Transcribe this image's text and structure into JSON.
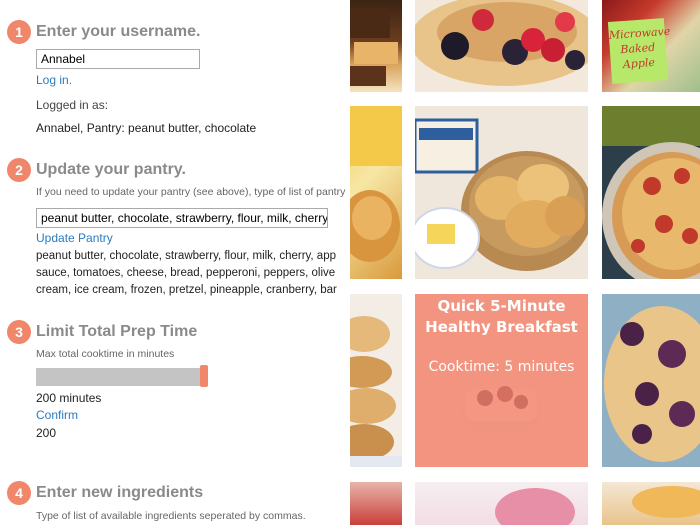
{
  "steps": [
    {
      "number": "1",
      "title": "Enter your username."
    },
    {
      "number": "2",
      "title": "Update your pantry."
    },
    {
      "number": "3",
      "title": "Limit Total Prep Time"
    },
    {
      "number": "4",
      "title": "Enter new ingredients"
    }
  ],
  "login": {
    "username_value": "Annabel",
    "login_link": "Log in.",
    "logged_in_label": "Logged in as:",
    "logged_in_info": "Annabel, Pantry: peanut butter, chocolate"
  },
  "pantry": {
    "hint": "If you need to update your pantry (see above), type of list of pantry",
    "input_value": "peanut butter, chocolate, strawberry, flour, milk, cherry",
    "update_link": "Update Pantry",
    "list_lines": [
      "peanut butter, chocolate, strawberry, flour, milk, cherry, app",
      "sauce, tomatoes, cheese, bread, pepperoni, peppers, olive",
      "cream, ice cream, frozen, pretzel, pineapple, cranberry, bar"
    ]
  },
  "prep_time": {
    "hint": "Max total cooktime in minutes",
    "slider_fraction": 1.0,
    "minutes_label": "200 minutes",
    "confirm_link": "Confirm",
    "confirmed_value": "200"
  },
  "ingredients": {
    "hint": "Type of list of available ingredients seperated by commas."
  },
  "recipe_grid": {
    "note_text": "Microwave Baked Apple",
    "featured_title_line1": "Quick 5-Minute",
    "featured_title_line2": "Healthy Breakfast",
    "featured_cooktime": "Cooktime: 5 minutes"
  },
  "colors": {
    "accent": "#f0866a",
    "link": "#2b7bbf",
    "overlay": "#f48064"
  }
}
